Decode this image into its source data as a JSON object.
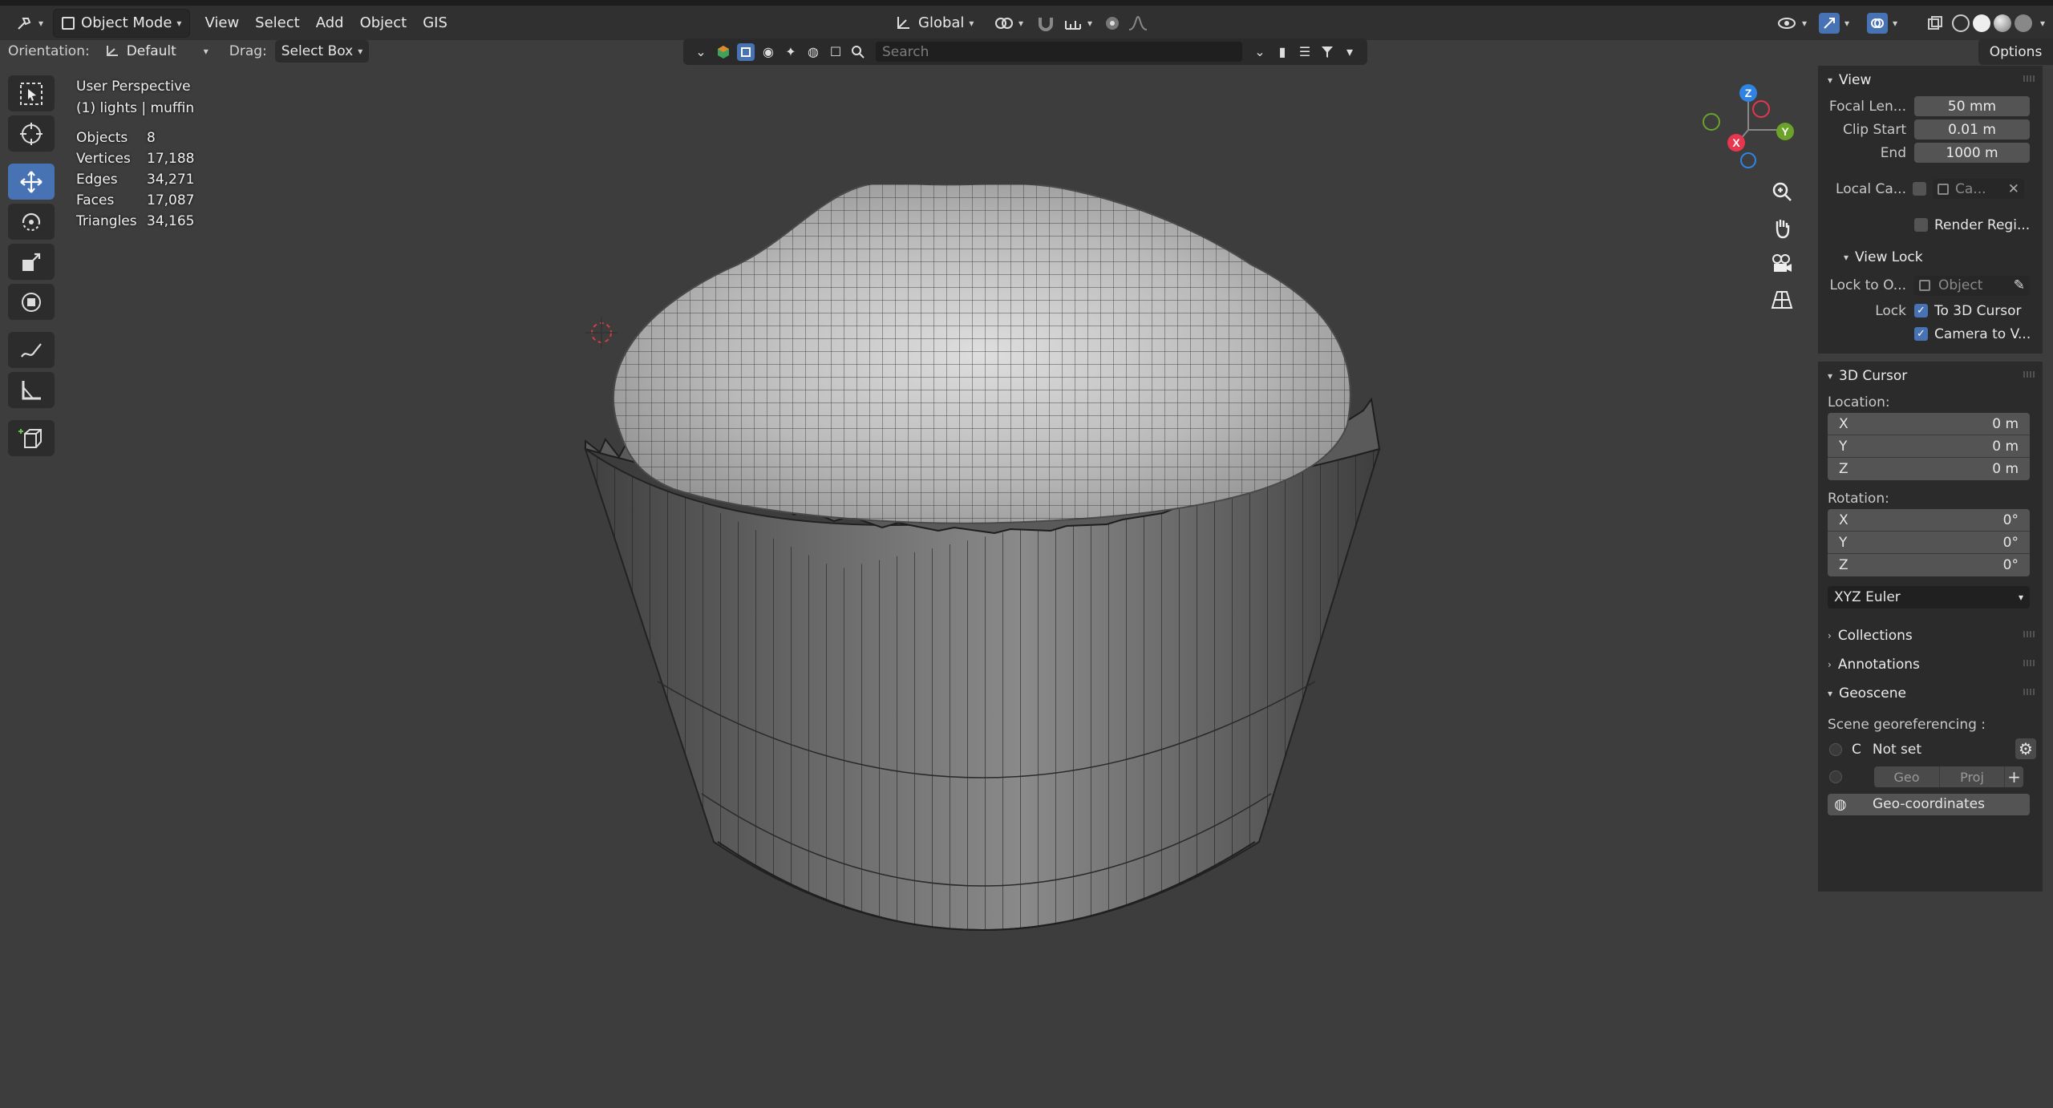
{
  "header": {
    "mode_label": "Object Mode",
    "menus": [
      "View",
      "Select",
      "Add",
      "Object",
      "GIS"
    ],
    "transform_orientation": "Global",
    "orientation_label": "Orientation:",
    "orientation_value": "Default",
    "drag_label": "Drag:",
    "drag_value": "Select Box",
    "options_label": "Options",
    "search_placeholder": "Search"
  },
  "overlay": {
    "perspective": "User Perspective",
    "collection": "(1) lights | muffin",
    "stats": [
      {
        "label": "Objects",
        "value": "8"
      },
      {
        "label": "Vertices",
        "value": "17,188"
      },
      {
        "label": "Edges",
        "value": "34,271"
      },
      {
        "label": "Faces",
        "value": "17,087"
      },
      {
        "label": "Triangles",
        "value": "34,165"
      }
    ]
  },
  "gizmo": {
    "x": "X",
    "y": "Y",
    "z": "Z"
  },
  "npanel": {
    "view": {
      "title": "View",
      "focal_label": "Focal Len...",
      "focal_value": "50 mm",
      "clip_start_label": "Clip Start",
      "clip_start_value": "0.01 m",
      "end_label": "End",
      "end_value": "1000 m",
      "local_camera_label": "Local Ca...",
      "local_camera_value": "Ca...",
      "render_region_label": "Render Regi..."
    },
    "view_lock": {
      "title": "View Lock",
      "lock_to_label": "Lock to O...",
      "lock_to_value": "Object",
      "lock_label": "Lock",
      "to_3d_cursor": "To 3D Cursor",
      "camera_to_view": "Camera to V..."
    },
    "cursor": {
      "title": "3D Cursor",
      "location_label": "Location:",
      "location": [
        {
          "axis": "X",
          "value": "0 m"
        },
        {
          "axis": "Y",
          "value": "0 m"
        },
        {
          "axis": "Z",
          "value": "0 m"
        }
      ],
      "rotation_label": "Rotation:",
      "rotation": [
        {
          "axis": "X",
          "value": "0°"
        },
        {
          "axis": "Y",
          "value": "0°"
        },
        {
          "axis": "Z",
          "value": "0°"
        }
      ],
      "rotation_mode": "XYZ Euler"
    },
    "collections_title": "Collections",
    "annotations_title": "Annotations",
    "geoscene": {
      "title": "Geoscene",
      "georef_label": "Scene georeferencing :",
      "c_label": "C",
      "not_set": "Not set",
      "geo_label": "Geo",
      "proj_label": "Proj",
      "geo_coords_label": "Geo-coordinates"
    }
  },
  "colors": {
    "accent": "#4772b3",
    "x_axis": "#e8364f",
    "y_axis": "#6ba22a",
    "z_axis": "#2f83e3"
  }
}
